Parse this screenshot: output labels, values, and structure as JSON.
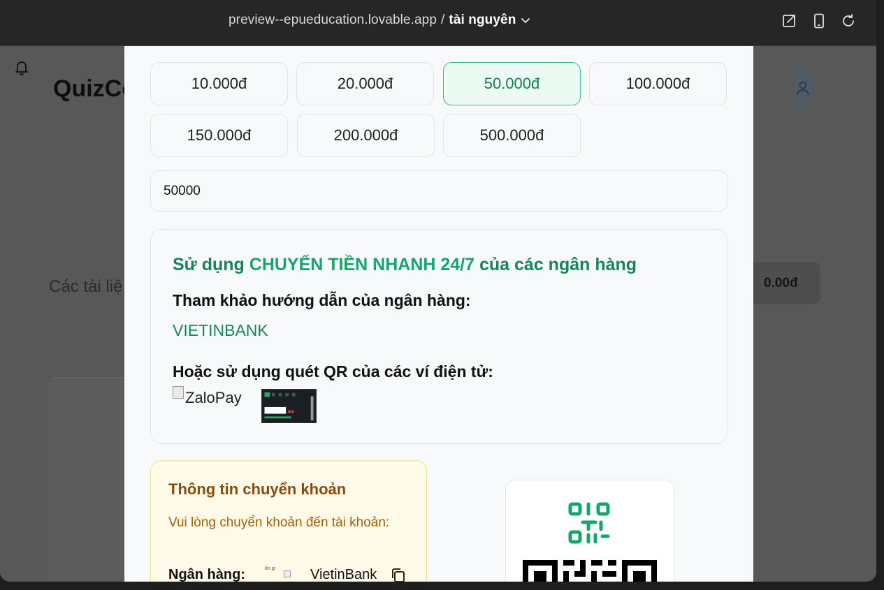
{
  "browser": {
    "url_host": "preview--epueducation.lovable.app",
    "separator": "/",
    "page_name": "tài nguyên",
    "icons": [
      "external-link-icon",
      "mobile-view-icon",
      "refresh-icon"
    ]
  },
  "background_app": {
    "title_partial": "QuizCo",
    "subtitle_partial": "Các tài liệ",
    "balance": "0.00đ"
  },
  "modal": {
    "amount_options": [
      {
        "label": "10.000đ",
        "selected": false
      },
      {
        "label": "20.000đ",
        "selected": false
      },
      {
        "label": "50.000đ",
        "selected": true
      },
      {
        "label": "100.000đ",
        "selected": false
      },
      {
        "label": "150.000đ",
        "selected": false
      },
      {
        "label": "200.000đ",
        "selected": false
      },
      {
        "label": "500.000đ",
        "selected": false
      }
    ],
    "amount_input_value": "50000",
    "bank_section": {
      "title_prefix": "Sử dụng ",
      "title_highlight": "CHUYỂN TIỀN NHANH 24/7",
      "title_suffix": " của các ngân hàng",
      "reference_label": "Tham khảo hướng dẫn của ngân hàng:",
      "bank_link": "VIETINBANK",
      "qr_label": "Hoặc sử dụng quét QR của các ví điện tử:",
      "zalopay_alt": "ZaloPay"
    },
    "transfer_info": {
      "title": "Thông tin chuyển khoản",
      "note": "Vui lòng chuyển khoản đến tài khoản:",
      "bank_label": "Ngân hàng:",
      "bank_value": "VietinBank",
      "mini_text": "ần\ngi"
    }
  },
  "colors": {
    "accent_green": "#16855a",
    "selected_bg": "#ebfaf2",
    "transfer_bg": "#fffbe8",
    "transfer_title": "#8a4a0c"
  }
}
